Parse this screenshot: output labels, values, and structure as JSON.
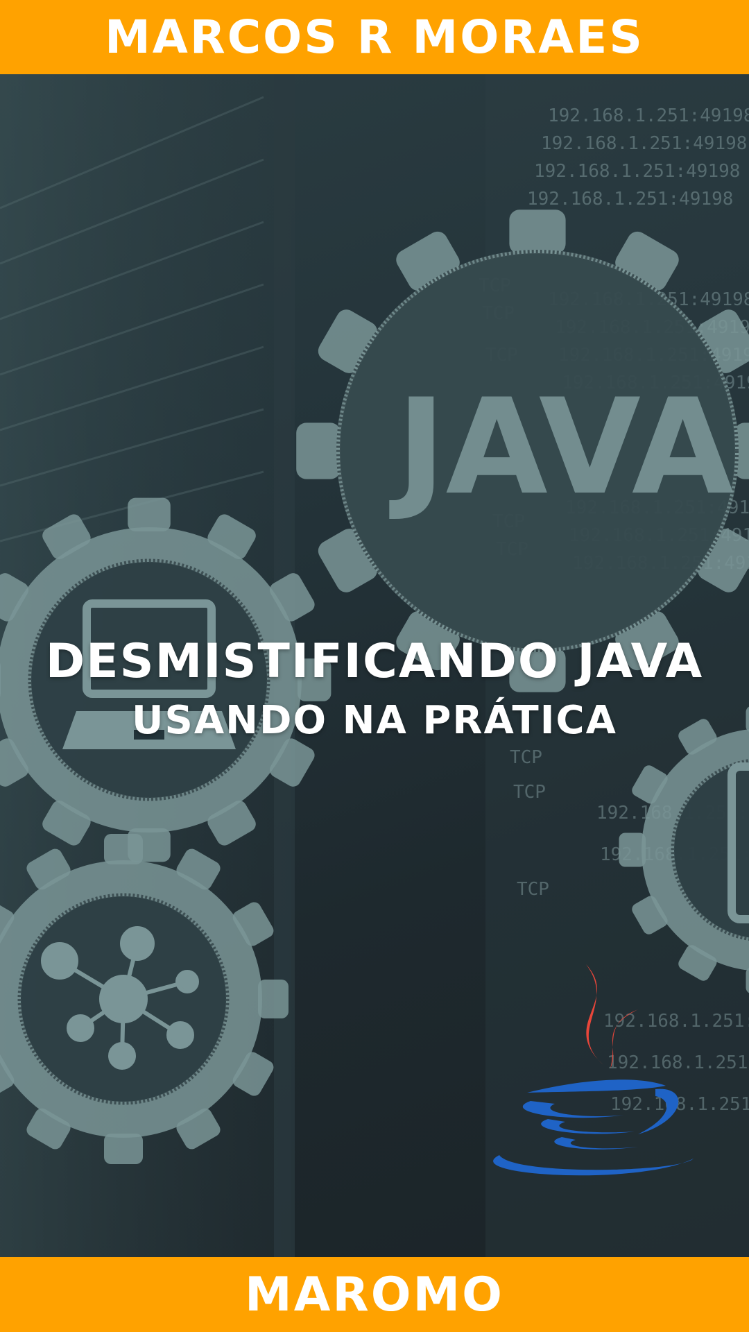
{
  "cover": {
    "author": "MARCOS R MORAES",
    "title": "DESMISTIFICANDO JAVA",
    "subtitle": "USANDO NA PRÁTICA",
    "gear_label": "JAVA",
    "publisher": "MAROMO",
    "ip_text": "192.168.1.251:49198",
    "protocol_text": "TCP"
  },
  "colors": {
    "band": "#ffa200",
    "gear": "#7a9597",
    "background": "#24343a",
    "java_flame": "#e8463a",
    "java_cup": "#1f63c6"
  },
  "icons": [
    "gear-icon",
    "laptop-icon",
    "network-icon",
    "java-logo"
  ]
}
